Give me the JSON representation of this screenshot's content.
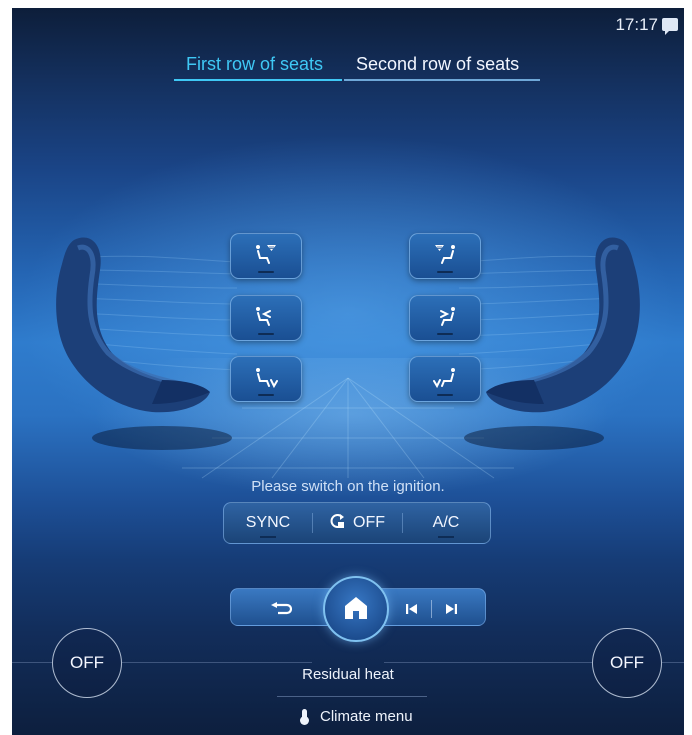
{
  "status_bar": {
    "time": "17:17",
    "icons": [
      "message-icon"
    ]
  },
  "tabs": [
    {
      "label": "First row of seats",
      "active": true
    },
    {
      "label": "Second row of seats",
      "active": false
    }
  ],
  "seat_buttons": {
    "left": [
      "seat-ventilation-fan-icon",
      "seat-upper-body-icon",
      "seat-footwell-icon"
    ],
    "right": [
      "seat-ventilation-fan-icon",
      "seat-upper-body-icon",
      "seat-footwell-icon"
    ]
  },
  "notice": "Please switch on the ignition.",
  "controls": {
    "sync_label": "SYNC",
    "recirc_label": "OFF",
    "ac_label": "A/C"
  },
  "nav": {
    "icons": [
      "back-icon",
      "home-icon",
      "previous-track-icon",
      "next-track-icon"
    ]
  },
  "left_off_label": "OFF",
  "right_off_label": "OFF",
  "residual_heat_label": "Residual heat",
  "climate_menu_label": "Climate menu",
  "colors": {
    "accent": "#3fc8f5",
    "background": "#1a4486",
    "button": "#1f508f"
  }
}
